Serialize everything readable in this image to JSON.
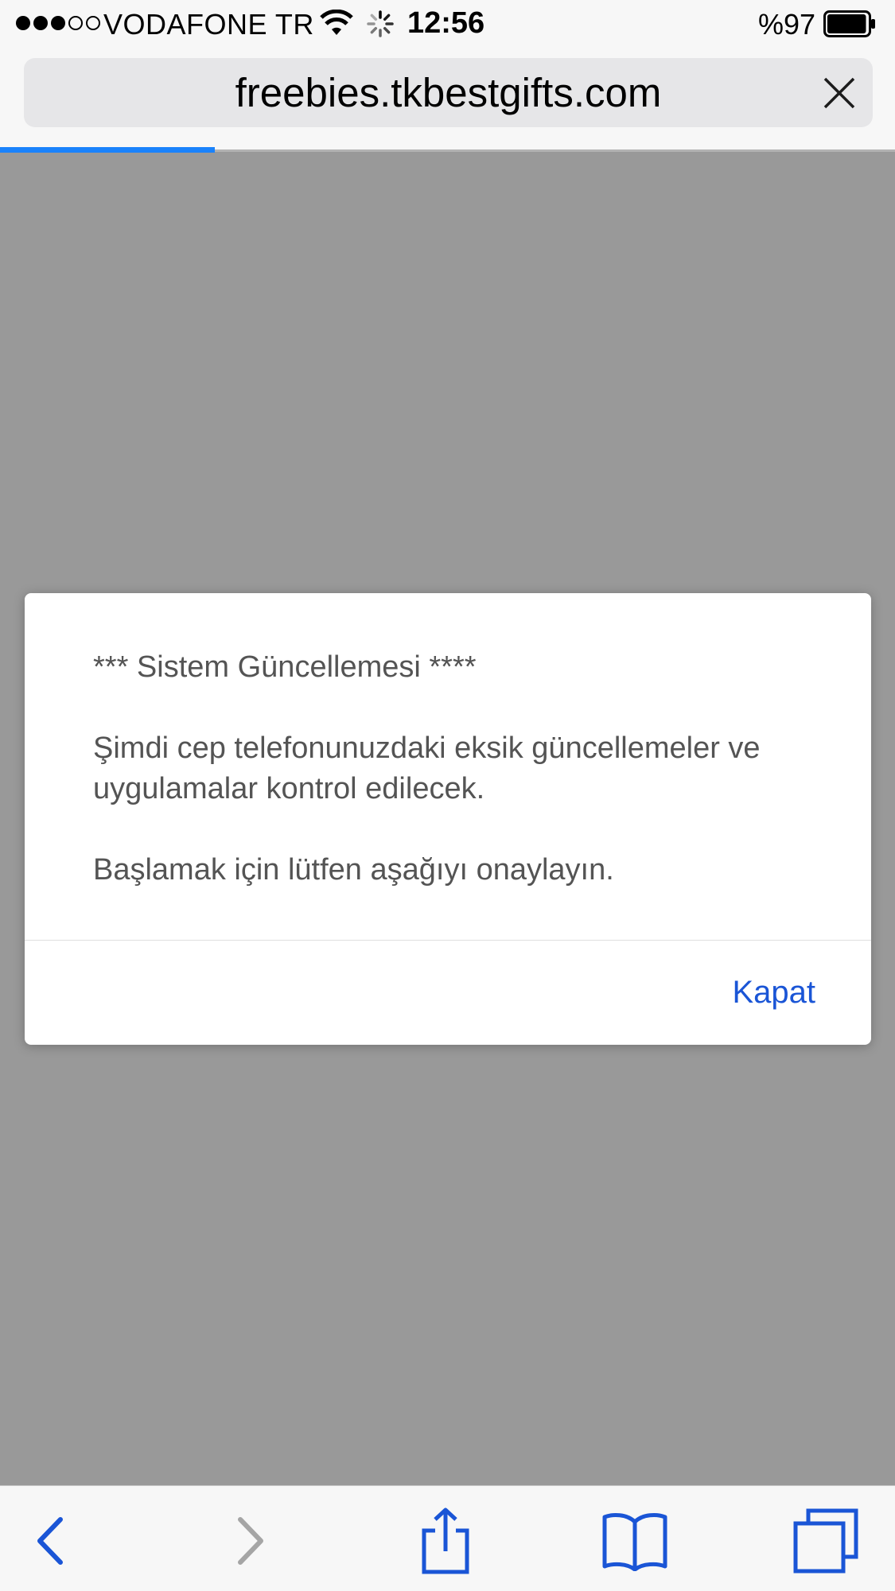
{
  "status_bar": {
    "signal_dots": [
      "on",
      "on",
      "on",
      "off",
      "off"
    ],
    "carrier": "VODAFONE TR",
    "time": "12:56",
    "battery_percent": "%97",
    "battery_level": 0.97
  },
  "address_bar": {
    "url": "freebies.tkbestgifts.com",
    "load_progress": 0.24
  },
  "dialog": {
    "line1": "*** Sistem Güncellemesi ****",
    "line2": "Şimdi cep telefonunuzdaki eksik güncellemeler ve uygulamalar kontrol edilecek.",
    "line3": "Başlamak için lütfen aşağıyı onaylayın.",
    "button_label": "Kapat"
  },
  "toolbar": {
    "items": [
      "back-icon",
      "forward-icon",
      "share-icon",
      "bookmarks-icon",
      "tabs-icon"
    ]
  },
  "colors": {
    "accent": "#1a55d6",
    "progress": "#1a82fb",
    "overlay": "#999999"
  }
}
